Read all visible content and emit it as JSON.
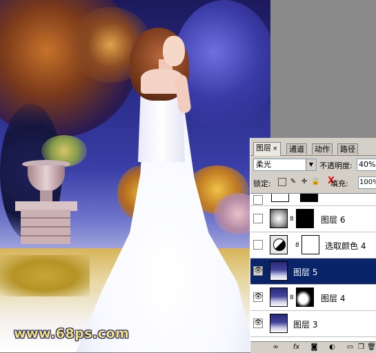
{
  "watermark": "www.68ps.com",
  "panel": {
    "tabs": [
      {
        "label": "图层",
        "active": true,
        "closable": true
      },
      {
        "label": "通道",
        "active": false
      },
      {
        "label": "动作",
        "active": false
      },
      {
        "label": "路径",
        "active": false
      }
    ],
    "tab_close_glyph": "×",
    "blend_mode": "柔光",
    "opacity_label": "不透明度:",
    "opacity_value": "40%",
    "lock_label": "锁定:",
    "fill_label": "填充:",
    "fill_value": "100%",
    "layers": [
      {
        "name": "",
        "visible": false,
        "thumb": "white",
        "mask": "black",
        "partial": true
      },
      {
        "name": "图层 6",
        "visible": false,
        "thumb": "grad",
        "mask": "black"
      },
      {
        "name": "选取颜色 4",
        "visible": false,
        "thumb": "adjustment",
        "mask": "white"
      },
      {
        "name": "图层 5",
        "visible": true,
        "thumb": "photo",
        "selected": true
      },
      {
        "name": "图层 4",
        "visible": true,
        "thumb": "photo",
        "mask": "black-mask"
      },
      {
        "name": "图层 3",
        "visible": true,
        "thumb": "photo"
      }
    ],
    "eye_glyph": "👁",
    "bottom_buttons": [
      "link-icon",
      "fx-icon",
      "mask-icon",
      "adjustment-icon",
      "group-icon",
      "new-layer-icon",
      "trash-icon"
    ]
  },
  "colors": {
    "selection": "#0a246a",
    "panel_bg": "#d4d0c8",
    "fill_x": "#e41010",
    "watermark": "#f2e27a"
  }
}
